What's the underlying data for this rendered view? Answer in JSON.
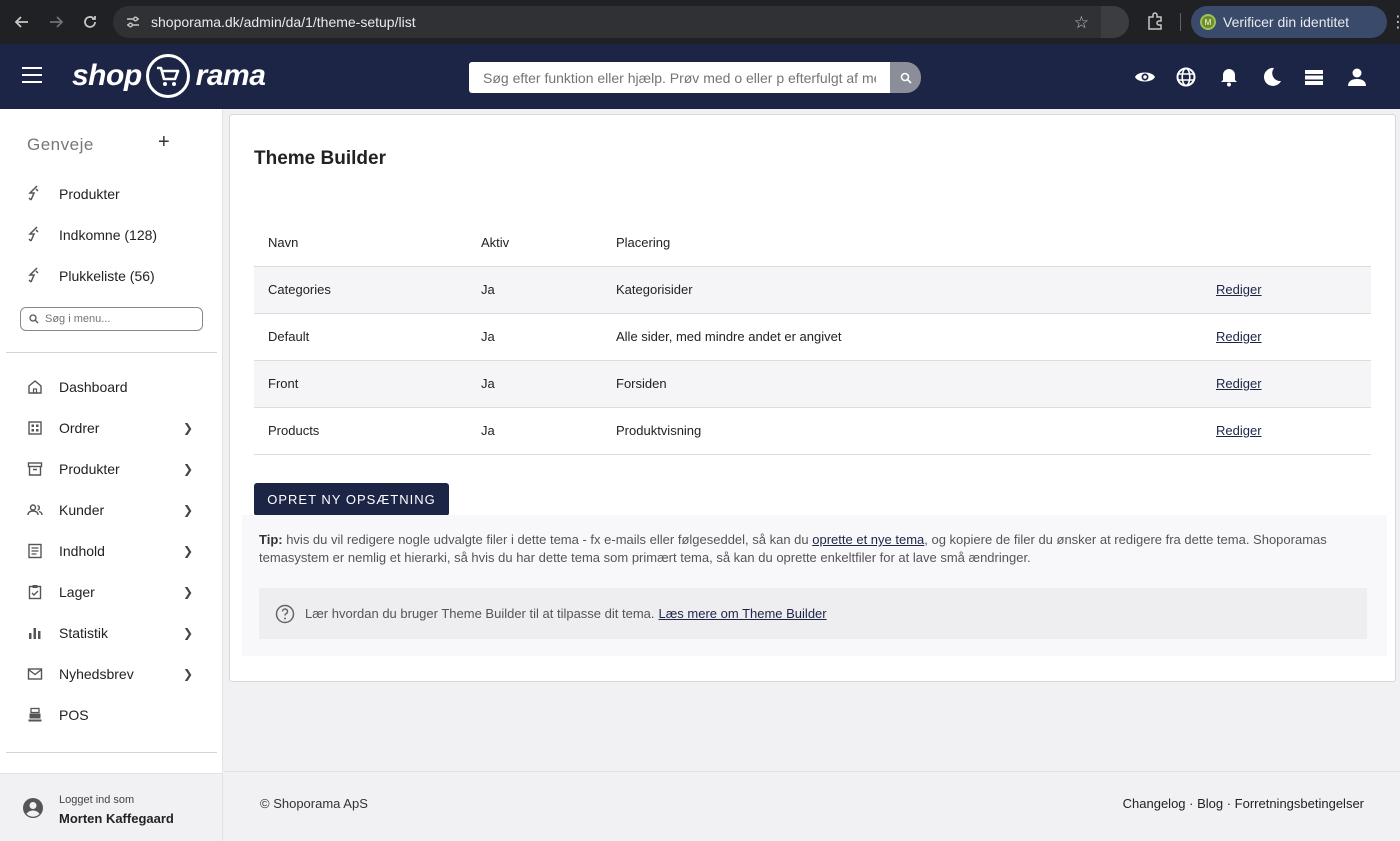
{
  "browser": {
    "url": "shoporama.dk/admin/da/1/theme-setup/list",
    "verify_label": "Verificer din identitet",
    "verify_avatar": "M"
  },
  "header": {
    "logo_left": "shop",
    "logo_right": "rama",
    "search_placeholder": "Søg efter funktion eller hjælp. Prøv med o eller p efterfulgt af me"
  },
  "sidebar": {
    "shortcuts_title": "Genveje",
    "shortcuts": [
      {
        "label": "Produkter"
      },
      {
        "label": "Indkomne (128)"
      },
      {
        "label": "Plukkeliste (56)"
      }
    ],
    "menu_search_placeholder": "Søg i menu...",
    "nav": [
      {
        "label": "Dashboard",
        "icon": "home-icon"
      },
      {
        "label": "Ordrer",
        "icon": "grid-icon"
      },
      {
        "label": "Produkter",
        "icon": "archive-icon"
      },
      {
        "label": "Kunder",
        "icon": "people-icon"
      },
      {
        "label": "Indhold",
        "icon": "document-icon"
      },
      {
        "label": "Lager",
        "icon": "clipboard-icon"
      },
      {
        "label": "Statistik",
        "icon": "bar-chart-icon"
      },
      {
        "label": "Nyhedsbrev",
        "icon": "mail-icon"
      },
      {
        "label": "POS",
        "icon": "register-icon"
      }
    ],
    "logged_in_label": "Logget ind som",
    "user_name": "Morten Kaffegaard"
  },
  "main": {
    "title": "Theme Builder",
    "columns": [
      "Navn",
      "Aktiv",
      "Placering"
    ],
    "rows": [
      {
        "name": "Categories",
        "active": "Ja",
        "placement": "Kategorisider",
        "action": "Rediger"
      },
      {
        "name": "Default",
        "active": "Ja",
        "placement": "Alle sider, med mindre andet er angivet",
        "action": "Rediger"
      },
      {
        "name": "Front",
        "active": "Ja",
        "placement": "Forsiden",
        "action": "Rediger"
      },
      {
        "name": "Products",
        "active": "Ja",
        "placement": "Produktvisning",
        "action": "Rediger"
      }
    ],
    "create_button": "OPRET NY OPSÆTNING",
    "tip_label": "Tip:",
    "tip_text_1": " hvis du vil redigere nogle udvalgte filer i dette tema - fx e-mails eller følgeseddel, så kan du ",
    "tip_link": "oprette et nye tema",
    "tip_text_2": ", og kopiere de filer du ønsker at redigere fra dette tema. Shoporamas temasystem er nemlig et hierarki, så hvis du har dette tema som primært tema, så kan du oprette enkeltfiler for at lave små ændringer.",
    "info_text": "Lær hvordan du bruger Theme Builder til at tilpasse dit tema.",
    "info_link": "Læs mere om Theme Builder"
  },
  "footer": {
    "copyright": "© Shoporama ApS",
    "links": "Changelog · Blog · Forretningsbetingelser"
  },
  "colors": {
    "brand_navy": "#1d2547"
  }
}
